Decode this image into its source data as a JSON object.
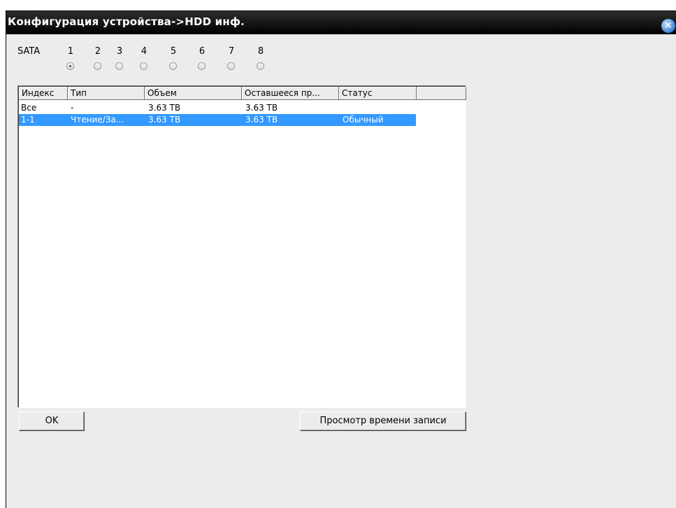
{
  "window": {
    "title": "Конфигурация устройства->HDD инф.",
    "close_glyph": "✕"
  },
  "sata": {
    "label": "SATA",
    "disks": [
      "1",
      "2",
      "3",
      "4",
      "5",
      "6",
      "7",
      "8"
    ],
    "selected": "1"
  },
  "table": {
    "columns": [
      "Индекс",
      "Тип",
      "Объем",
      "Оставшееся пр...",
      "Статус",
      ""
    ],
    "rows": [
      {
        "index": "Все",
        "type": "-",
        "capacity": "3.63 TB",
        "remaining": "3.63 TB",
        "status": "",
        "selected": false
      },
      {
        "index": "1-1",
        "type": "Чтение/За...",
        "capacity": "3.63 TB",
        "remaining": "3.63 TB",
        "status": "Обычный",
        "selected": true
      }
    ],
    "selection_color": "#3399ff"
  },
  "buttons": {
    "ok": "OK",
    "view_record_time": "Просмотр времени записи"
  }
}
